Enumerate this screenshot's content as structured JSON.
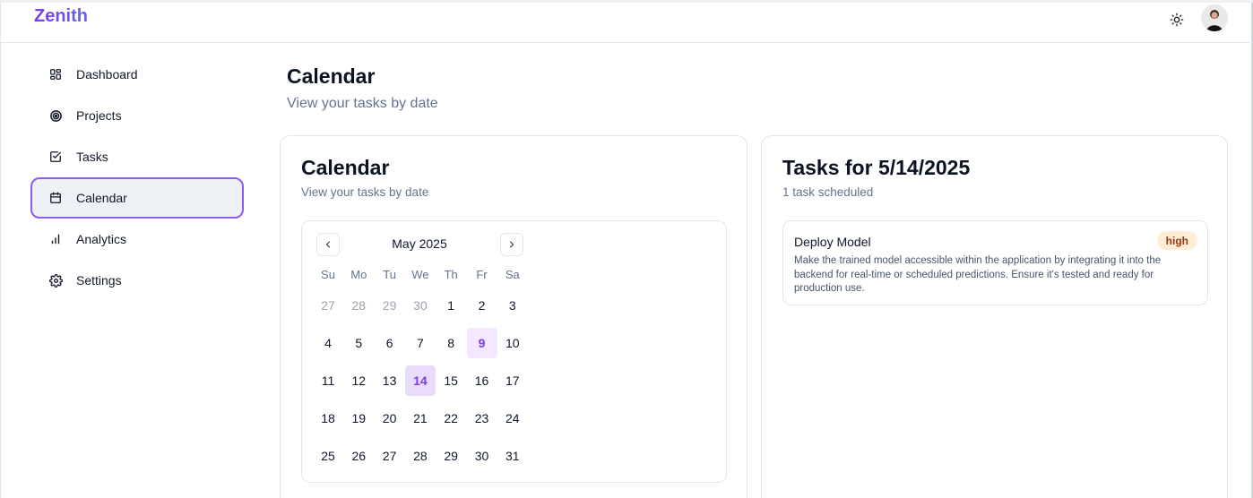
{
  "app": {
    "brand": "Zenith"
  },
  "header": {
    "theme_icon": "sun-icon",
    "avatar": "user-avatar"
  },
  "sidebar": {
    "items": [
      {
        "label": "Dashboard",
        "icon": "dashboard-grid-icon",
        "active": false
      },
      {
        "label": "Projects",
        "icon": "target-icon",
        "active": false
      },
      {
        "label": "Tasks",
        "icon": "check-square-icon",
        "active": false
      },
      {
        "label": "Calendar",
        "icon": "calendar-icon",
        "active": true
      },
      {
        "label": "Analytics",
        "icon": "bar-chart-icon",
        "active": false
      },
      {
        "label": "Settings",
        "icon": "gear-icon",
        "active": false
      }
    ]
  },
  "page": {
    "title": "Calendar",
    "subtitle": "View your tasks by date"
  },
  "calendar_card": {
    "title": "Calendar",
    "subtitle": "View your tasks by date",
    "month_label": "May 2025",
    "weekdays": [
      "Su",
      "Mo",
      "Tu",
      "We",
      "Th",
      "Fr",
      "Sa"
    ],
    "weeks": [
      [
        "27",
        "28",
        "29",
        "30",
        "1",
        "2",
        "3"
      ],
      [
        "4",
        "5",
        "6",
        "7",
        "8",
        "9",
        "10"
      ],
      [
        "11",
        "12",
        "13",
        "14",
        "15",
        "16",
        "17"
      ],
      [
        "18",
        "19",
        "20",
        "21",
        "22",
        "23",
        "24"
      ],
      [
        "25",
        "26",
        "27",
        "28",
        "29",
        "30",
        "31"
      ]
    ],
    "outside_days_first_week": 4,
    "today": "9",
    "selected": "14"
  },
  "tasks_card": {
    "title": "Tasks for 5/14/2025",
    "subtitle": "1 task scheduled",
    "tasks": [
      {
        "title": "Deploy Model",
        "description": "Make the trained model accessible within the application by integrating it into the backend for real-time or scheduled predictions. Ensure it's tested and ready for production use.",
        "priority": "high"
      }
    ]
  },
  "colors": {
    "accent": "#8b5cf6",
    "brand": "#7c3aed",
    "badge_bg": "#ffedd5",
    "badge_text": "#9a3412"
  }
}
